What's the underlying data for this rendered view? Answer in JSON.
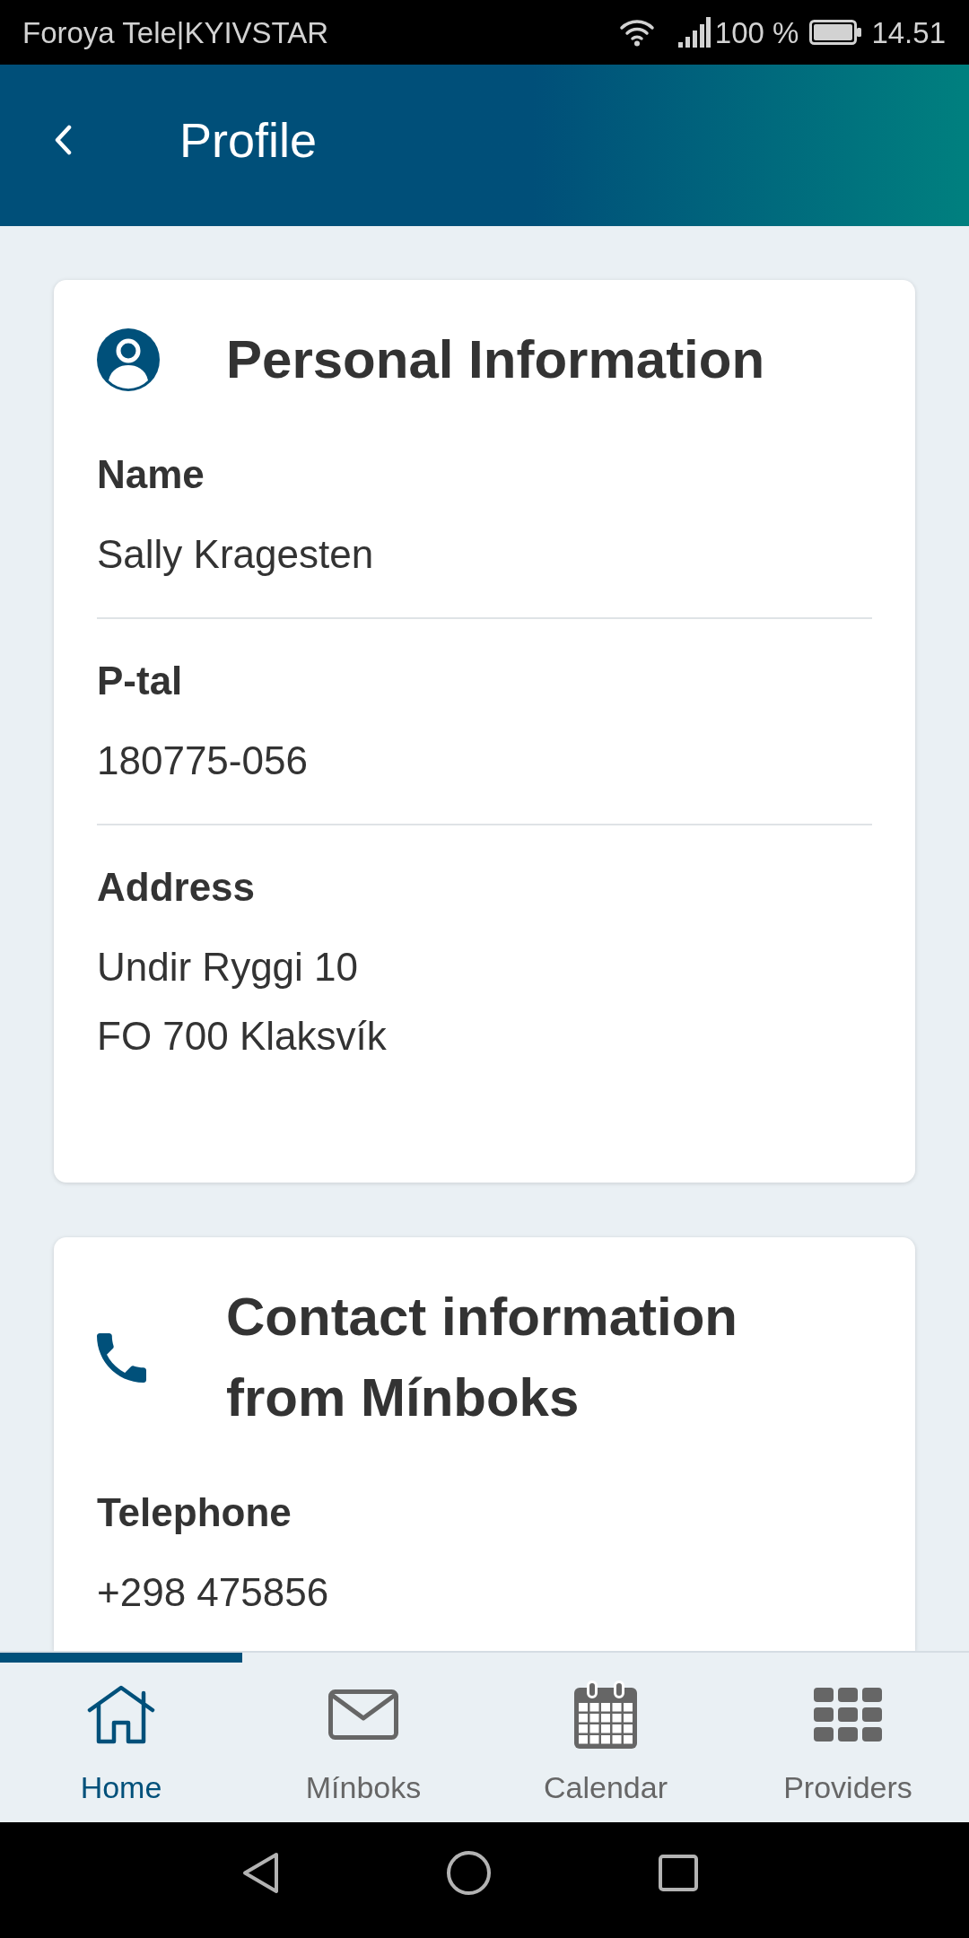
{
  "status_bar": {
    "carrier": "Foroya Tele|KYIVSTAR",
    "battery": "100 %",
    "time": "14.51"
  },
  "header": {
    "title": "Profile"
  },
  "cards": [
    {
      "title": "Personal Information",
      "fields": [
        {
          "label": "Name",
          "lines": [
            "Sally Kragesten"
          ]
        },
        {
          "label": "P-tal",
          "lines": [
            "180775-056"
          ]
        },
        {
          "label": "Address",
          "lines": [
            "Undir Ryggi 10",
            "FO 700 Klaksvík"
          ]
        }
      ]
    },
    {
      "title": "Contact information from Mínboks",
      "fields": [
        {
          "label": "Telephone",
          "lines": [
            "+298 475856"
          ]
        }
      ]
    }
  ],
  "bottom_nav": [
    {
      "label": "Home",
      "selected": true
    },
    {
      "label": "Mínboks",
      "selected": false
    },
    {
      "label": "Calendar",
      "selected": false
    },
    {
      "label": "Providers",
      "selected": false
    }
  ]
}
